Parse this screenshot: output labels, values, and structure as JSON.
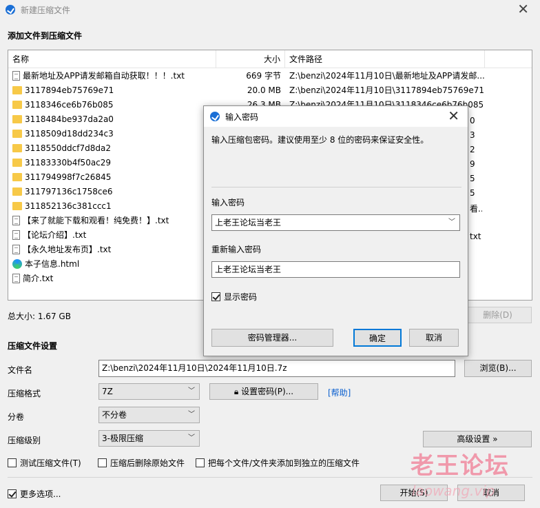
{
  "window": {
    "title": "新建压缩文件"
  },
  "add_section": {
    "title": "添加文件到压缩文件"
  },
  "file_list": {
    "columns": {
      "name": "名称",
      "size": "大小",
      "path": "文件路径"
    },
    "rows": [
      {
        "icon": "text-file-icon",
        "name": "最新地址及APP请发邮箱自动获取！！！.txt",
        "size": "669 字节",
        "path": "Z:\\benzi\\2024年11月10日\\最新地址及APP请发邮..."
      },
      {
        "icon": "folder-icon",
        "name": "3117894eb75769e71",
        "size": "20.0 MB",
        "path": "Z:\\benzi\\2024年11月10日\\3117894eb75769e71"
      },
      {
        "icon": "folder-icon",
        "name": "3118346ce6b76b085",
        "size": "26.3 MB",
        "path": "Z:\\benzi\\2024年11月10日\\3118346ce6b76b085"
      },
      {
        "icon": "folder-icon",
        "name": "3118484be937da2a0",
        "size": "",
        "path": ""
      },
      {
        "icon": "folder-icon",
        "name": "3118509d18dd234c3",
        "size": "",
        "path": ""
      },
      {
        "icon": "folder-icon",
        "name": "3118550ddcf7d8da2",
        "size": "",
        "path": ""
      },
      {
        "icon": "folder-icon",
        "name": "31183330b4f50ac29",
        "size": "",
        "path": ""
      },
      {
        "icon": "folder-icon",
        "name": "311794998f7c26845",
        "size": "",
        "path": ""
      },
      {
        "icon": "folder-icon",
        "name": "311797136c1758ce6",
        "size": "",
        "path": ""
      },
      {
        "icon": "folder-icon",
        "name": "311852136c381ccc1",
        "size": "",
        "path": ""
      },
      {
        "icon": "text-file-icon",
        "name": "【来了就能下载和观看！纯免费！】.txt",
        "size": "",
        "path": ""
      },
      {
        "icon": "text-file-icon",
        "name": "【论坛介绍】.txt",
        "size": "",
        "path": ""
      },
      {
        "icon": "text-file-icon",
        "name": "【永久地址发布页】.txt",
        "size": "",
        "path": ""
      },
      {
        "icon": "edge-icon",
        "name": "本子信息.html",
        "size": "",
        "path": ""
      },
      {
        "icon": "text-file-icon",
        "name": "简介.txt",
        "size": "",
        "path": ""
      }
    ],
    "partial_right_edges": [
      "0",
      "3",
      "2",
      "9",
      "5",
      "5",
      "看...",
      "",
      "txt"
    ]
  },
  "total": {
    "label": "总大小: 1.67 GB"
  },
  "delete_button": "删除(D)",
  "settings": {
    "title": "压缩文件设置",
    "filename_label": "文件名",
    "filename_value": "Z:\\benzi\\2024年11月10日\\2024年11月10日.7z",
    "browse_button": "浏览(B)...",
    "format_label": "压缩格式",
    "format_value": "7Z",
    "set_password_button": "设置密码(P)...",
    "help_link": "[帮助]",
    "split_label": "分卷",
    "split_value": "不分卷",
    "level_label": "压缩级别",
    "level_value": "3-极限压缩",
    "advanced_button": "高级设置 »",
    "test_checkbox": "测试压缩文件(T)",
    "delete_after_checkbox": "压缩后删除原始文件",
    "separate_checkbox": "把每个文件/文件夹添加到独立的压缩文件",
    "more_options_checkbox": "更多选项...",
    "start_button": "开始(S)",
    "cancel_button": "取消"
  },
  "watermark": {
    "text": "老王论坛",
    "url": "laowang.vip"
  },
  "dialog": {
    "title": "输入密码",
    "description": "输入压缩包密码。建议使用至少 8 位的密码来保证安全性。",
    "password_label": "输入密码",
    "password_value": "上老王论坛当老王",
    "confirm_label": "重新输入密码",
    "confirm_value": "上老王论坛当老王",
    "show_password": "显示密码",
    "manager_button": "密码管理器...",
    "ok_button": "确定",
    "cancel_button": "取消"
  }
}
